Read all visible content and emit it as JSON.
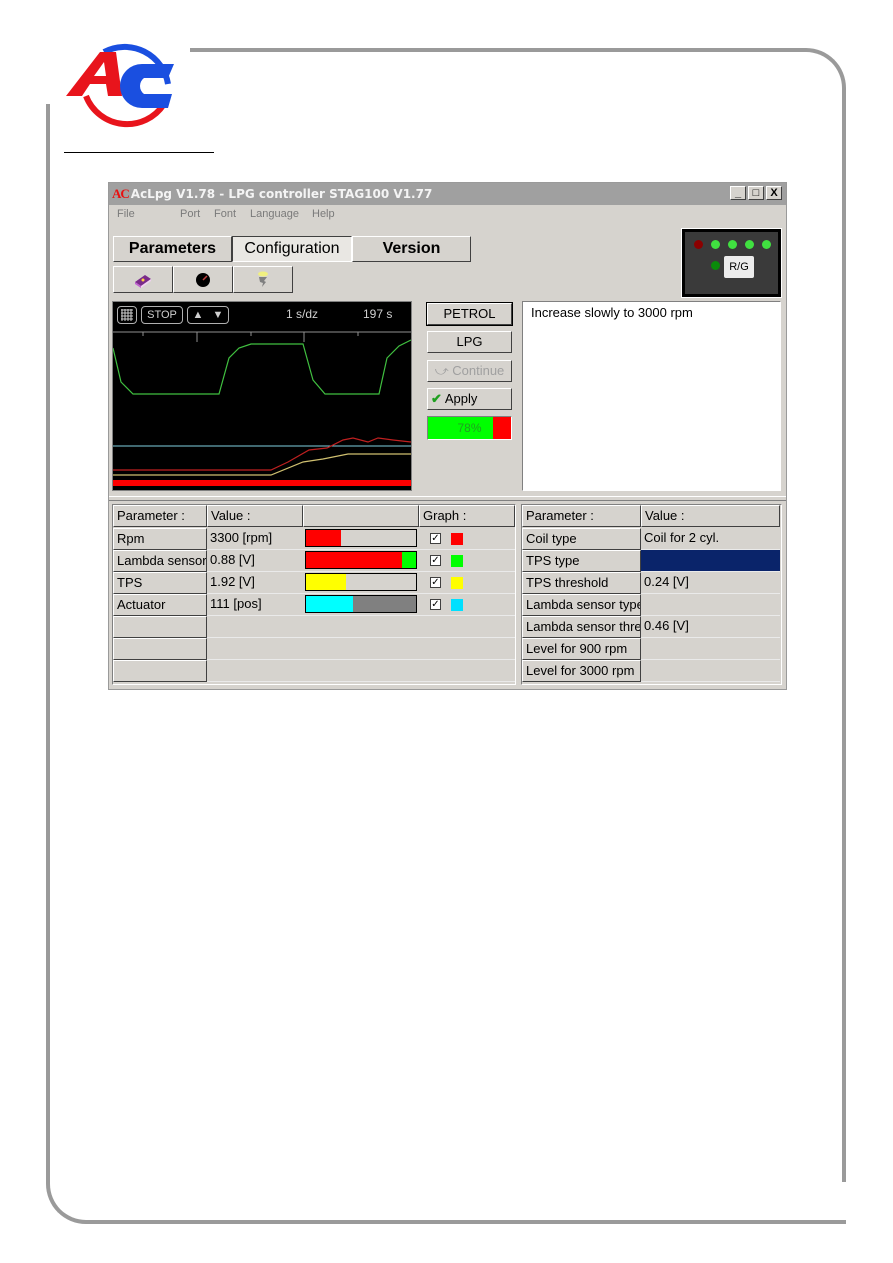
{
  "brand": {
    "logo_letters": "AC",
    "primary_color": "#e8141c",
    "secondary_color": "#1a4fe0"
  },
  "window": {
    "title_logo": "AC",
    "title": "AcLpg V1.78 - LPG controller STAG100 V1.77",
    "controls": {
      "minimize": "_",
      "maximize": "□",
      "close": "X"
    }
  },
  "menu": [
    "File",
    "Port",
    "Font",
    "Language",
    "Help"
  ],
  "tabs": [
    {
      "label": "Parameters",
      "active": false
    },
    {
      "label": "Configuration",
      "active": true
    },
    {
      "label": "Version",
      "active": false
    }
  ],
  "toolbar": [
    {
      "icon": "book-icon"
    },
    {
      "icon": "gauge-icon"
    },
    {
      "icon": "lamp-icon"
    }
  ],
  "status_panel": {
    "leds": [
      {
        "name": "led-red",
        "color": "#8b0000"
      },
      {
        "name": "led-1",
        "color": "#40e040"
      },
      {
        "name": "led-2",
        "color": "#40e040"
      },
      {
        "name": "led-3",
        "color": "#40e040"
      },
      {
        "name": "led-4",
        "color": "#40e040"
      },
      {
        "name": "led-mode",
        "color": "#0a8a0a"
      }
    ],
    "rg_label": "R/G"
  },
  "scope": {
    "grid_button": "grid-icon",
    "stop_label": "STOP",
    "up_label": "▲",
    "down_label": "▼",
    "timebase": "1 s/dz",
    "elapsed": "197 s"
  },
  "actions": {
    "petrol": "PETROL",
    "lpg": "LPG",
    "continue": "Continue",
    "apply": "Apply",
    "progress_percent": 78,
    "progress_label": "78%"
  },
  "message": "Increase slowly to 3000 rpm",
  "live_table": {
    "headers": [
      "Parameter :",
      "Value :",
      "",
      "Graph :"
    ],
    "rows": [
      {
        "param": "Rpm",
        "value": "3300 [rpm]",
        "bar": [
          {
            "fraction": 0.32,
            "color": "#ff0000"
          }
        ],
        "bar_bg": "#d6d3ce",
        "graph": true,
        "color": "#ff0000"
      },
      {
        "param": "Lambda sensor",
        "value": "0.88 [V]",
        "bar": [
          {
            "fraction": 0.87,
            "color": "#ff0000"
          },
          {
            "fraction": 0.13,
            "color": "#00ff00"
          }
        ],
        "bar_bg": "#d6d3ce",
        "graph": true,
        "color": "#00ff00"
      },
      {
        "param": "TPS",
        "value": "1.92 [V]",
        "bar": [
          {
            "fraction": 0.36,
            "color": "#ffff00"
          }
        ],
        "bar_bg": "#d6d3ce",
        "graph": true,
        "color": "#ffff00"
      },
      {
        "param": "Actuator",
        "value": "111 [pos]",
        "bar": [
          {
            "fraction": 0.43,
            "color": "#00ffff"
          }
        ],
        "bar_bg": "#808080",
        "graph": true,
        "color": "#00e0ff"
      },
      {
        "param": "",
        "value": ""
      },
      {
        "param": "",
        "value": ""
      },
      {
        "param": "",
        "value": ""
      }
    ]
  },
  "config_table": {
    "headers": [
      "Parameter :",
      "Value :"
    ],
    "rows": [
      {
        "param": "Coil type",
        "value": "Coil for 2 cyl."
      },
      {
        "param": "TPS type",
        "value": "",
        "selected": true
      },
      {
        "param": "TPS threshold",
        "value": "0.24 [V]"
      },
      {
        "param": "Lambda sensor type",
        "value": ""
      },
      {
        "param": "Lambda sensor threshold",
        "value": "0.46 [V]"
      },
      {
        "param": "Level for 900 rpm",
        "value": ""
      },
      {
        "param": "Level for 3000 rpm",
        "value": ""
      }
    ]
  }
}
